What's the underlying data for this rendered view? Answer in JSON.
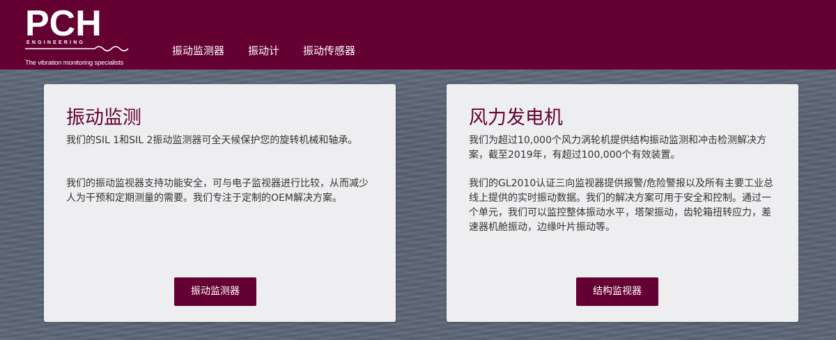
{
  "logo": {
    "word": "PCH",
    "sub": "ENGINEERING",
    "tagline": "The vibration monitoring specialists"
  },
  "nav": {
    "items": [
      "振动监测器",
      "振动计",
      "振动传感器"
    ]
  },
  "cards": [
    {
      "title": "振动监测",
      "paragraphs": [
        "我们的SIL 1和SIL 2振动监测器可全天候保护您的旋转机械和轴承。",
        "我们的振动监视器支持功能安全，可与电子监视器进行比较，从而减少人为干预和定期测量的需要。我们专注于定制的OEM解决方案。"
      ],
      "button": "振动监测器"
    },
    {
      "title": "风力发电机",
      "paragraphs": [
        "我们为超过10,000个风力涡轮机提供结构振动监测和冲击检测解决方案，截至2019年，有超过100,000个有效装置。",
        "我们的GL2010认证三向监视器提供报警/危险警报以及所有主要工业总线上提供的实时振动数据。我们的解决方案可用于安全和控制。通过一个单元，我们可以监控整体振动水平，塔架振动，齿轮箱扭转应力，差速器机舱振动，边缘叶片振动等。"
      ],
      "button": "结构监视器"
    }
  ],
  "colors": {
    "brand": "#650032",
    "card_bg": "#f5f5f7",
    "text": "#333333"
  }
}
